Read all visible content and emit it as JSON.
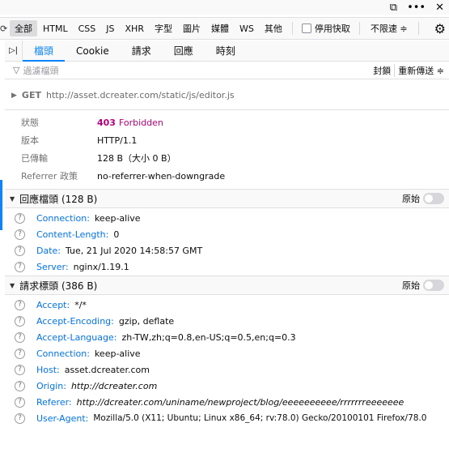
{
  "top_icons": {
    "undock": "undock-icon",
    "more": "•••",
    "close": "✕"
  },
  "filter_types": [
    "全部",
    "HTML",
    "CSS",
    "JS",
    "XHR",
    "字型",
    "圖片",
    "媒體",
    "WS",
    "其他"
  ],
  "active_filter_index": 0,
  "disable_cache_label": "停用快取",
  "throttle_label": "不限速 ≑",
  "tabs": [
    "檔頭",
    "Cookie",
    "請求",
    "回應",
    "時刻"
  ],
  "active_tab_index": 0,
  "header_filter": {
    "placeholder": "過濾檔頭",
    "block_label": "封鎖",
    "resend_label": "重新傳送 ≑"
  },
  "request": {
    "method": "GET",
    "url": "http://asset.dcreater.com/static/js/editor.js"
  },
  "summary": {
    "status_label": "狀態",
    "status_code": "403",
    "status_text": "Forbidden",
    "version_label": "版本",
    "version": "HTTP/1.1",
    "transferred_label": "已傳輸",
    "transferred": "128 B（大小 0 B）",
    "referrer_label": "Referrer 政策",
    "referrer": "no-referrer-when-downgrade"
  },
  "response_section": {
    "title": "回應檔頭 (128 B)",
    "raw_label": "原始"
  },
  "response_headers": [
    {
      "name": "Connection:",
      "value": "keep-alive"
    },
    {
      "name": "Content-Length:",
      "value": "0"
    },
    {
      "name": "Date:",
      "value": "Tue, 21 Jul 2020 14:58:57 GMT"
    },
    {
      "name": "Server:",
      "value": "nginx/1.19.1"
    }
  ],
  "request_section": {
    "title": "請求標頭 (386 B)",
    "raw_label": "原始"
  },
  "request_headers": [
    {
      "name": "Accept:",
      "value": "*/*"
    },
    {
      "name": "Accept-Encoding:",
      "value": "gzip, deflate"
    },
    {
      "name": "Accept-Language:",
      "value": "zh-TW,zh;q=0.8,en-US;q=0.5,en;q=0.3"
    },
    {
      "name": "Connection:",
      "value": "keep-alive"
    },
    {
      "name": "Host:",
      "value": "asset.dcreater.com"
    },
    {
      "name": "Origin:",
      "value": "http://dcreater.com"
    },
    {
      "name": "Referer:",
      "value": "http://dcreater.com/uniname/newproject/blog/eeeeeeeeee/rrrrrrreeeeeee"
    },
    {
      "name": "User-Agent:",
      "value": "Mozilla/5.0 (X11; Ubuntu; Linux x86_64; rv:78.0) Gecko/20100101 Firefox/78.0"
    }
  ]
}
